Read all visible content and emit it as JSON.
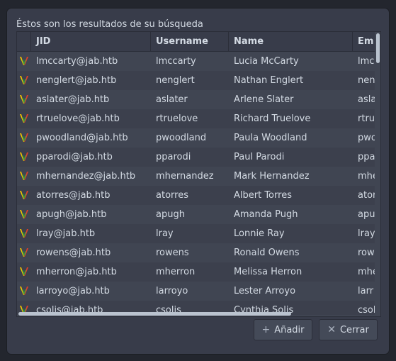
{
  "dialog": {
    "heading": "Éstos son los resultados de su búsqueda"
  },
  "table": {
    "columns": [
      "JID",
      "Username",
      "Name",
      "Em"
    ],
    "rows": [
      {
        "jid": "lmccarty@jab.htb",
        "username": "lmccarty",
        "name": "Lucia McCarty",
        "email": "lmc"
      },
      {
        "jid": "nenglert@jab.htb",
        "username": "nenglert",
        "name": "Nathan Englert",
        "email": "nen"
      },
      {
        "jid": "aslater@jab.htb",
        "username": "aslater",
        "name": "Arlene Slater",
        "email": "asla"
      },
      {
        "jid": "rtruelove@jab.htb",
        "username": "rtruelove",
        "name": "Richard Truelove",
        "email": "rtru"
      },
      {
        "jid": "pwoodland@jab.htb",
        "username": "pwoodland",
        "name": "Paula Woodland",
        "email": "pwo"
      },
      {
        "jid": "pparodi@jab.htb",
        "username": "pparodi",
        "name": "Paul Parodi",
        "email": "ppa"
      },
      {
        "jid": "mhernandez@jab.htb",
        "username": "mhernandez",
        "name": "Mark Hernandez",
        "email": "mhe"
      },
      {
        "jid": "atorres@jab.htb",
        "username": "atorres",
        "name": "Albert Torres",
        "email": "ator"
      },
      {
        "jid": "apugh@jab.htb",
        "username": "apugh",
        "name": "Amanda Pugh",
        "email": "apu"
      },
      {
        "jid": "lray@jab.htb",
        "username": "lray",
        "name": "Lonnie Ray",
        "email": "lray"
      },
      {
        "jid": "rowens@jab.htb",
        "username": "rowens",
        "name": "Ronald Owens",
        "email": "row"
      },
      {
        "jid": "mherron@jab.htb",
        "username": "mherron",
        "name": "Melissa Herron",
        "email": "mhe"
      },
      {
        "jid": "larroyo@jab.htb",
        "username": "larroyo",
        "name": "Lester Arroyo",
        "email": "larr"
      },
      {
        "jid": "csolis@jab.htb",
        "username": "csolis",
        "name": "Cynthia Solis",
        "email": "csol"
      }
    ],
    "row_icon": "spark-user-icon"
  },
  "buttons": {
    "add_label": "Añadir",
    "add_icon": "plus-icon",
    "close_label": "Cerrar",
    "close_icon": "close-icon"
  },
  "colors": {
    "background": "#383c4a",
    "table_bg": "#404552",
    "text": "#d3dae3",
    "icon_yellow": "#f5c400",
    "icon_red": "#e0402a",
    "icon_green": "#3a9a3a"
  }
}
